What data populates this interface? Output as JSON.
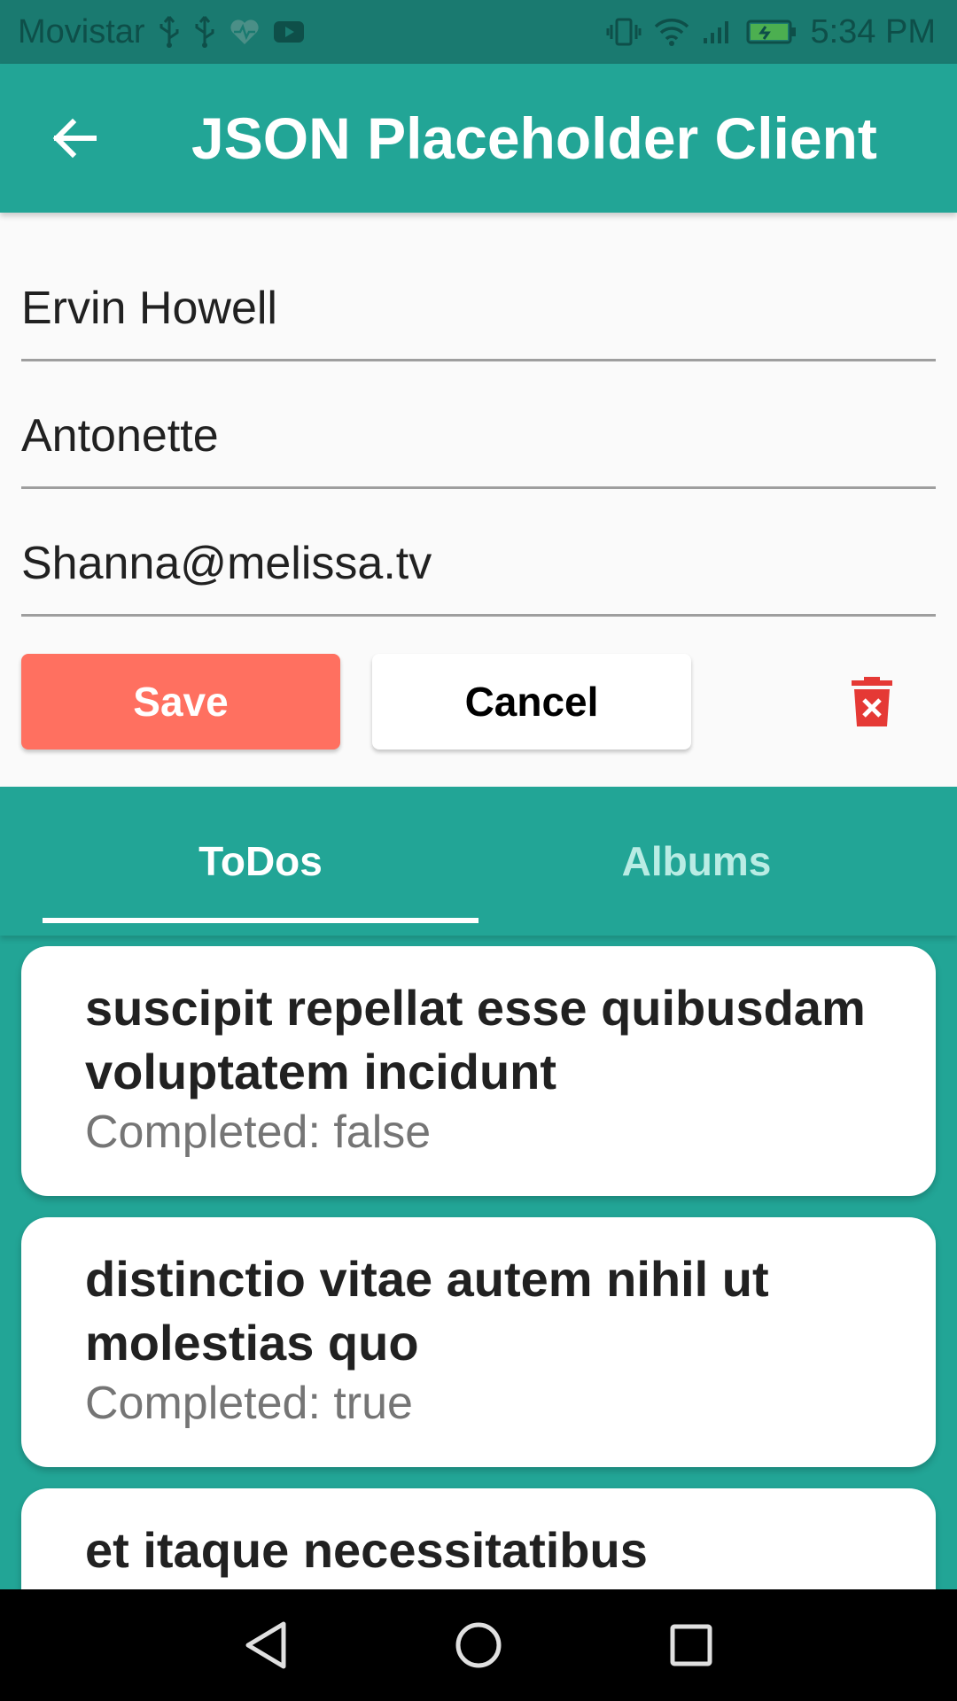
{
  "status_bar": {
    "carrier": "Movistar",
    "time": "5:34 PM",
    "left_icons": [
      "usb-icon",
      "usb-icon",
      "health-heart-icon",
      "youtube-icon"
    ],
    "right_icons": [
      "vibrate-icon",
      "wifi-icon",
      "signal-icon",
      "battery-charging-icon"
    ]
  },
  "app_bar": {
    "title": "JSON Placeholder Client",
    "back_icon": "arrow-back-icon"
  },
  "form": {
    "name_value": "Ervin Howell",
    "username_value": "Antonette",
    "email_value": "Shanna@melissa.tv",
    "save_label": "Save",
    "cancel_label": "Cancel",
    "delete_icon": "delete-forever-icon"
  },
  "tabs": [
    {
      "label": "ToDos",
      "selected": true
    },
    {
      "label": "Albums",
      "selected": false
    }
  ],
  "todos": [
    {
      "title": "suscipit repellat esse quibusdam voluptatem incidunt",
      "status": "Completed: false"
    },
    {
      "title": "distinctio vitae autem nihil ut molestias quo",
      "status": "Completed: true"
    },
    {
      "title": "et itaque necessitatibus",
      "status": ""
    }
  ],
  "nav_bar": {
    "icons": [
      "nav-back-icon",
      "nav-home-icon",
      "nav-recents-icon"
    ]
  },
  "colors": {
    "primary": "#22a596",
    "status_bar": "#1a7a70",
    "save_button": "#ff7060",
    "delete_icon": "#e53935",
    "battery": "#4caf50"
  }
}
